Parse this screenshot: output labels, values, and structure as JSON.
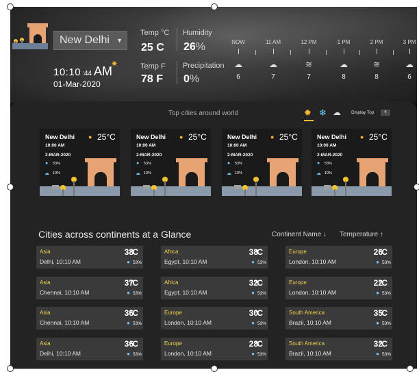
{
  "header": {
    "city_select": {
      "value": "New Delhi",
      "caret_icon": "chevron-down-icon"
    },
    "clock": {
      "hour_minute": "10:10",
      "seconds": ":44",
      "ampm": "AM"
    },
    "date": "01-Mar-2020",
    "temp_c": {
      "label": "Temp °C",
      "value": "25 C"
    },
    "temp_f": {
      "label": "Temp F",
      "value": "78 F"
    },
    "humidity": {
      "label": "Humidity",
      "value": "26",
      "unit": "%"
    },
    "precipitation": {
      "label": "Precipitation",
      "value": "0",
      "unit": "%"
    },
    "hourly": [
      {
        "label": "NOW",
        "icon": "cloud-rain-icon",
        "value": "6"
      },
      {
        "label": "11 AM",
        "icon": "cloud-rain-icon",
        "value": "7"
      },
      {
        "label": "12 PM",
        "icon": "windy-icon",
        "value": "7"
      },
      {
        "label": "1 PM",
        "icon": "cloud-rain-icon",
        "value": "8"
      },
      {
        "label": "2 PM",
        "icon": "windy-icon",
        "value": "8"
      },
      {
        "label": "3 PM",
        "icon": "cloud-rain-icon",
        "value": "6"
      }
    ]
  },
  "top_cities": {
    "title": "Top cities around world",
    "display_top_label": "Display Top",
    "display_top_value": "4",
    "preference_icons": [
      "sun-icon",
      "snowflake-icon",
      "rain-cloud-icon"
    ],
    "cards": [
      {
        "city": "New Delhi",
        "temp": "25°C",
        "time": "10:00 AM",
        "date": "2-MAR-2020",
        "humidity": "53%",
        "precipitation": "10%"
      },
      {
        "city": "New Delhi",
        "temp": "25°C",
        "time": "10:00 AM",
        "date": "2-MAR-2020",
        "humidity": "53%",
        "precipitation": "10%"
      },
      {
        "city": "New Delhi",
        "temp": "25°C",
        "time": "10:00 AM",
        "date": "2-MAR-2020",
        "humidity": "53%",
        "precipitation": "10%"
      },
      {
        "city": "New Delhi",
        "temp": "25°C",
        "time": "10:00 AM",
        "date": "2-MAR-2020",
        "humidity": "53%",
        "precipitation": "10%"
      }
    ]
  },
  "continents": {
    "title": "Cities across continents at a Glance",
    "sort_continent": "Continent Name",
    "sort_continent_arrow": "↓",
    "sort_temperature": "Temperature",
    "sort_temperature_arrow": "↑",
    "tiles": [
      {
        "continent": "Asia",
        "city": "Delhi, 10:10 AM",
        "temp": "38",
        "humidity": "53%"
      },
      {
        "continent": "Africa",
        "city": "Egypt, 10:10 AM",
        "temp": "38",
        "humidity": "53%"
      },
      {
        "continent": "Europe",
        "city": "London, 10:10 AM",
        "temp": "26",
        "humidity": "53%"
      },
      {
        "continent": "Asia",
        "city": "Chennai, 10:10 AM",
        "temp": "37",
        "humidity": "53%"
      },
      {
        "continent": "Africa",
        "city": "Egypt, 10:10 AM",
        "temp": "32",
        "humidity": "53%"
      },
      {
        "continent": "Europe",
        "city": "London, 10:10 AM",
        "temp": "22",
        "humidity": "53%"
      },
      {
        "continent": "Asia",
        "city": "Chennai, 10:10 AM",
        "temp": "36",
        "humidity": "53%"
      },
      {
        "continent": "Europe",
        "city": "London, 10:10 AM",
        "temp": "30",
        "humidity": "53%"
      },
      {
        "continent": "South America",
        "city": "Brazil, 10:10 AM",
        "temp": "35",
        "humidity": "53%"
      },
      {
        "continent": "Asia",
        "city": "Delhi, 10:10 AM",
        "temp": "36",
        "humidity": "53%"
      },
      {
        "continent": "Europe",
        "city": "London, 10:10 AM",
        "temp": "28",
        "humidity": "53%"
      },
      {
        "continent": "South America",
        "city": "Brazil, 10:10 AM",
        "temp": "32",
        "humidity": "53%"
      }
    ],
    "degree_unit": "°C"
  },
  "colors": {
    "accent_yellow": "#f1d34a",
    "sun": "#f7b731",
    "water": "#6fc8ff",
    "monument": "#e6a474"
  }
}
